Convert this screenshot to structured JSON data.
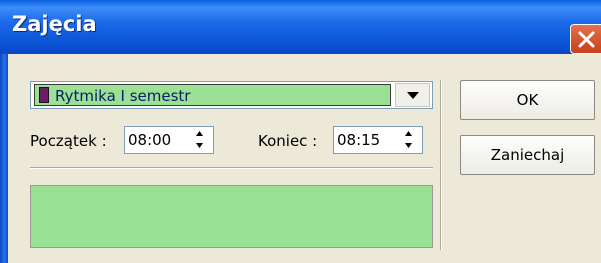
{
  "window": {
    "title": "Zajęcia",
    "close_icon": "close-icon"
  },
  "activity_select": {
    "selected": "Rytmika I semestr",
    "swatch_color": "#6b1f62",
    "field_color": "#9ae095"
  },
  "start_time": {
    "label": "Początek :",
    "value": "08:00"
  },
  "end_time": {
    "label": "Koniec :",
    "value": "08:15"
  },
  "buttons": {
    "ok_label": "OK",
    "cancel_label": "Zaniechaj"
  },
  "colors": {
    "titlebar": "#0b53d6",
    "client_bg": "#ece9d8",
    "preview_box": "#97e094"
  }
}
